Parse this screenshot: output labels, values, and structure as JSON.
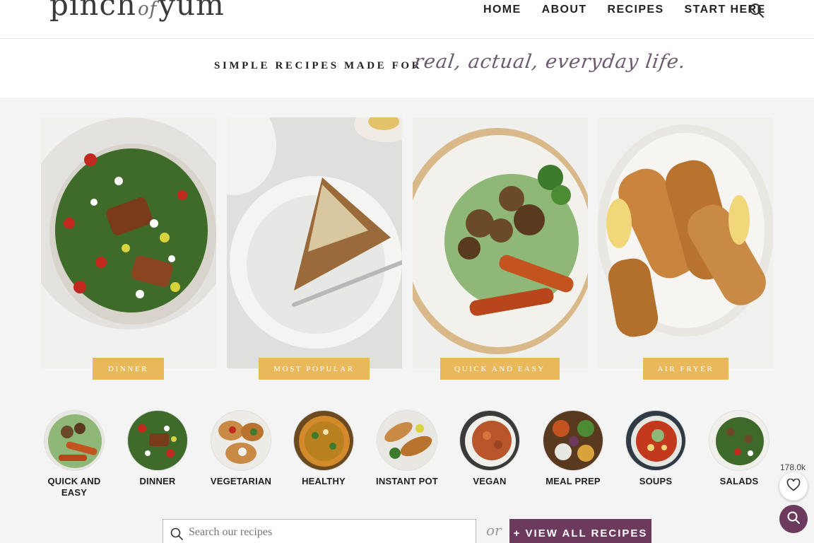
{
  "header": {
    "logo": {
      "main1": "pinch",
      "of": "of",
      "main2": "yum"
    },
    "nav": [
      "HOME",
      "ABOUT",
      "RECIPES",
      "START HERE"
    ]
  },
  "tagline": {
    "plain": "SIMPLE RECIPES MADE FOR",
    "script": "real, actual, everyday life."
  },
  "features": [
    {
      "label": "DINNER"
    },
    {
      "label": "MOST POPULAR"
    },
    {
      "label": "QUICK AND EASY"
    },
    {
      "label": "AIR FRYER"
    }
  ],
  "categories": [
    {
      "label": "QUICK AND EASY"
    },
    {
      "label": "DINNER"
    },
    {
      "label": "VEGETARIAN"
    },
    {
      "label": "HEALTHY"
    },
    {
      "label": "INSTANT POT"
    },
    {
      "label": "VEGAN"
    },
    {
      "label": "MEAL PREP"
    },
    {
      "label": "SOUPS"
    },
    {
      "label": "SALADS"
    }
  ],
  "search": {
    "placeholder": "Search our recipes",
    "or": "or",
    "view_all": "+ VIEW ALL RECIPES"
  },
  "favorites": {
    "count": "178.0k"
  },
  "colors": {
    "badge": "#e9b85b",
    "brand_purple": "#6b3a5c",
    "tagline_script": "#6b5a6d"
  }
}
